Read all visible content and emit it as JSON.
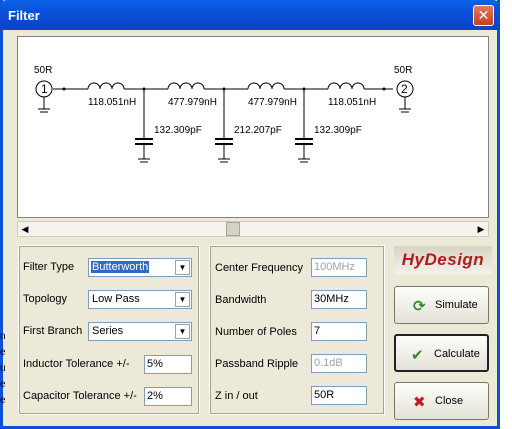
{
  "window": {
    "title": "Filter",
    "close_glyph": "✕"
  },
  "schematic": {
    "port1": {
      "label": "50R",
      "number": "1"
    },
    "port2": {
      "label": "50R",
      "number": "2"
    },
    "inductors": [
      "118.051nH",
      "477.979nH",
      "477.979nH",
      "118.051nH"
    ],
    "capacitors": [
      "132.309pF",
      "212.207pF",
      "132.309pF"
    ]
  },
  "left_panel": {
    "filter_type": {
      "label": "Filter Type",
      "value": "Butterworth"
    },
    "topology": {
      "label": "Topology",
      "value": "Low Pass"
    },
    "first_branch": {
      "label": "First Branch",
      "value": "Series"
    },
    "inductor_tol": {
      "label": "Inductor Tolerance +/-",
      "value": "5%"
    },
    "capacitor_tol": {
      "label": "Capacitor Tolerance +/-",
      "value": "2%"
    }
  },
  "mid_panel": {
    "center_freq": {
      "label": "Center Frequency",
      "value": "100MHz"
    },
    "bandwidth": {
      "label": "Bandwidth",
      "value": "30MHz"
    },
    "num_poles": {
      "label": "Number of Poles",
      "value": "7"
    },
    "passband_ripple": {
      "label": "Passband Ripple",
      "value": "0.1dB"
    },
    "z_in_out": {
      "label": "Z in / out",
      "value": "50R"
    }
  },
  "logo": "HyDesign",
  "buttons": {
    "simulate": {
      "label": "Simulate",
      "icon": "refresh-icon"
    },
    "calculate": {
      "label": "Calculate",
      "icon": "check-icon"
    },
    "close": {
      "label": "Close",
      "icon": "x-icon"
    }
  },
  "background_edge": [
    "n",
    "e",
    "u",
    "e",
    "e"
  ]
}
